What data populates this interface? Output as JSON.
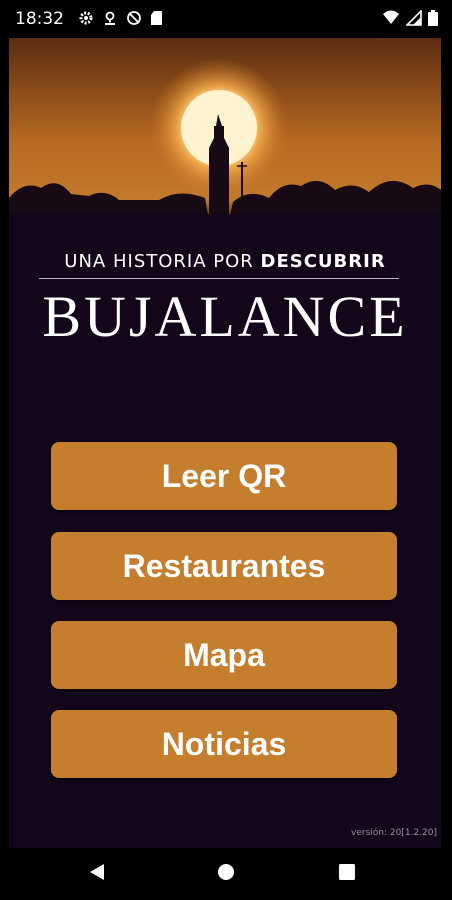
{
  "status": {
    "time": "18:32",
    "left_icons": [
      "settings-icon",
      "location-icon",
      "sync-off-icon",
      "sd-card-icon"
    ],
    "right_icons": [
      "wifi-icon",
      "signal-icon",
      "battery-icon"
    ]
  },
  "hero": {
    "image": "sunset-church-tower-silhouette",
    "colors": {
      "sky_top": "#5b2d10",
      "sky_mid": "#c27224",
      "sky_glow": "#e89a3b",
      "sun": "#fff4cf",
      "silhouette": "#170a14"
    }
  },
  "branding": {
    "tagline_prefix": "UNA HISTORIA POR ",
    "tagline_bold": "DESCUBRIR",
    "title": "BUJALANCE"
  },
  "menu": {
    "qr": "Leer QR",
    "restaurants": "Restaurantes",
    "map": "Mapa",
    "news": "Noticias",
    "button_color": "#c47e2e"
  },
  "footer": {
    "version": "versión: 20[1.2.20]"
  },
  "nav": {
    "back": "back-icon",
    "home": "home-icon",
    "recents": "recents-icon"
  }
}
